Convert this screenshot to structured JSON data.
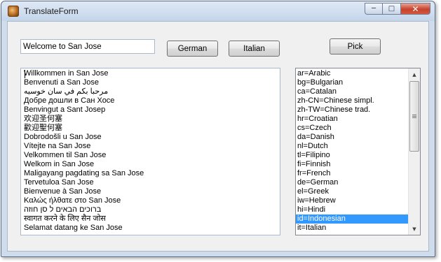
{
  "window": {
    "title": "TranslateForm",
    "minimize_glyph": "─",
    "maximize_glyph": "□",
    "close_glyph": "✕"
  },
  "input": {
    "value": "Welcome to San Jose"
  },
  "buttons": {
    "german": "German",
    "italian": "Italian",
    "pick": "Pick"
  },
  "translations": [
    "Willkommen in San Jose",
    "Benvenuti a San Jose",
    "مرحبا بكم في سان خوسيه",
    "Добре дошли в Сан Хосе",
    "Benvingut a Sant Josep",
    "欢迎圣何塞",
    "歡迎聖何塞",
    "Dobrodošli u San Jose",
    "Vítejte na San Jose",
    "Velkommen til San Jose",
    "Welkom in San Jose",
    "Maligayang pagdating sa San Jose",
    "Tervetuloa San Jose",
    "Bienvenue à San Jose",
    "Καλώς ήλθατε στο San Jose",
    "ברוכים הבאים ל סן חוזה",
    "स्वागत करने के लिए सैन जोस",
    "Selamat datang ke San Jose"
  ],
  "languages": [
    "ar=Arabic",
    "bg=Bulgarian",
    "ca=Catalan",
    "zh-CN=Chinese simpl.",
    "zh-TW=Chinese trad.",
    "hr=Croatian",
    "cs=Czech",
    "da=Danish",
    "nl=Dutch",
    "tl=Filipino",
    "fi=Finnish",
    "fr=French",
    "de=German",
    "el=Greek",
    "iw=Hebrew",
    "hi=Hindi",
    "id=Indonesian",
    "it=Italian"
  ],
  "selected_language": "id=Indonesian",
  "colors": {
    "selection": "#3399ff",
    "window_frame": "#cfdcec",
    "client_bg": "#f0f0f0"
  }
}
